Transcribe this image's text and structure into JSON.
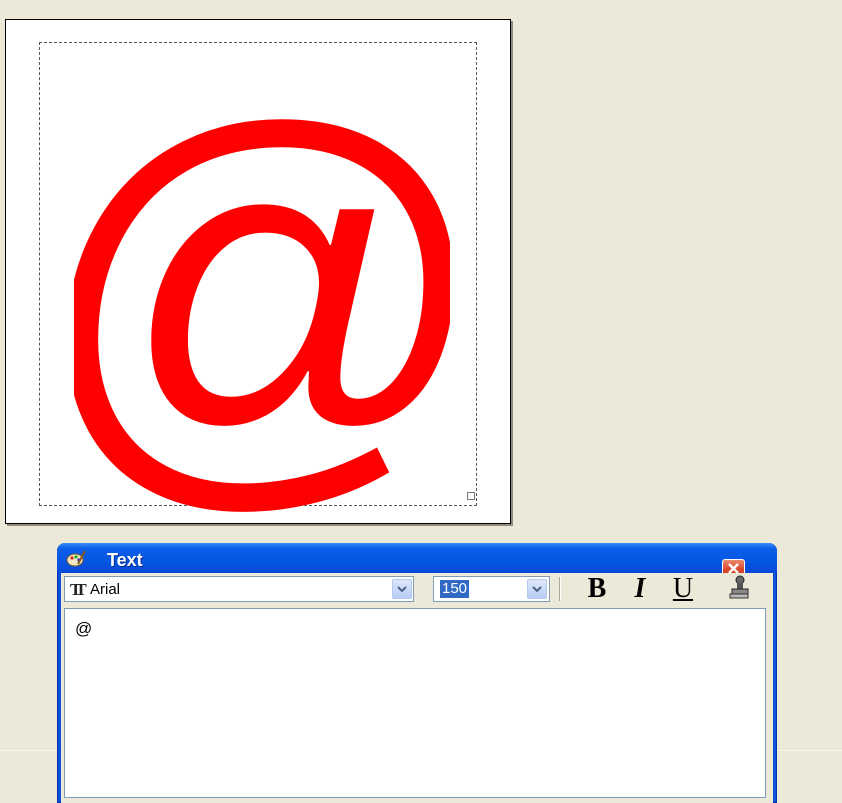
{
  "canvas": {
    "glyph_text": "@",
    "glyph_color": "#ff0000"
  },
  "dialog": {
    "title": "Text",
    "font": {
      "selected": "Arial",
      "icon": "font-tt-icon"
    },
    "size": {
      "selected": "150"
    },
    "format_buttons": {
      "bold": "B",
      "italic": "I",
      "underline": "U",
      "stamp_icon": "stamp-icon"
    },
    "text_value": "@"
  },
  "colors": {
    "desktop": "#ece9d8",
    "titlebar": "#0656e4",
    "close": "#d9472b",
    "selection_highlight": "#316ac5"
  }
}
